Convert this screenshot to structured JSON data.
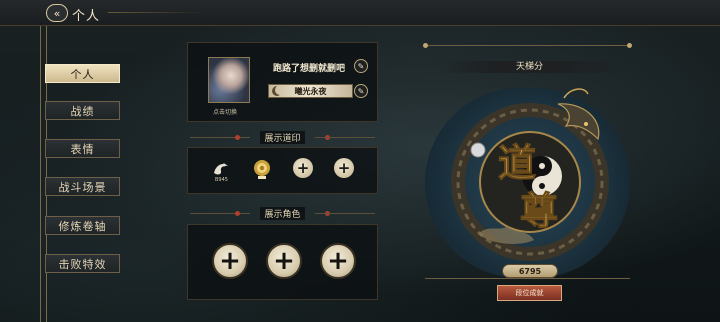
{
  "header": {
    "back_icon": "double-chevron-left-icon",
    "title": "个人"
  },
  "nav": {
    "items": [
      {
        "label": "个人",
        "active": true
      },
      {
        "label": "战绩",
        "active": false
      },
      {
        "label": "表情",
        "active": false
      },
      {
        "label": "战斗场景",
        "active": false
      },
      {
        "label": "修炼卷轴",
        "active": false
      },
      {
        "label": "击败特效",
        "active": false
      }
    ]
  },
  "profile": {
    "username": "跑路了想删就删吧",
    "avatar_caption": "点击切换",
    "title_badge": "曦光永夜",
    "edit_icon": "pencil-icon"
  },
  "seals": {
    "section_title": "展示道印",
    "seal1_label": "B945",
    "slots": [
      "seal-emblem",
      "seal-emblem",
      "plus",
      "plus"
    ]
  },
  "roles": {
    "section_title": "展示角色",
    "slots": [
      "plus",
      "plus",
      "plus"
    ]
  },
  "ladder": {
    "title": "天梯分",
    "rank_text_top": "道",
    "rank_text_bottom": "尊",
    "score": "6795",
    "achievement_button": "段位成就"
  },
  "colors": {
    "accent_gold": "#cdb98f",
    "accent_red": "#b23e2e",
    "panel_bg": "#0c1012"
  }
}
